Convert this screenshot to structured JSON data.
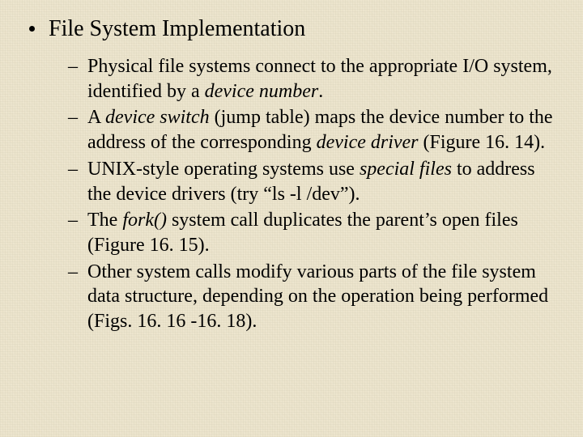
{
  "slide": {
    "title": "File System Implementation",
    "dash": "–",
    "items": [
      {
        "seg0": "Physical file systems connect to the appropriate I/O system, identified by a ",
        "em1": "device number",
        "seg2": "."
      },
      {
        "seg0": "A ",
        "em1": "device switch",
        "seg2": " (jump table) maps the device number to the address of the corresponding ",
        "em3": "device driver",
        "seg4": " (Figure 16. 14)."
      },
      {
        "seg0": "UNIX-style operating systems use ",
        "em1": "special files",
        "seg2": " to address the device drivers (try “ls -l /dev”)."
      },
      {
        "seg0": "The ",
        "em1": "fork()",
        "seg2": " system call duplicates the parent’s open files (Figure 16. 15)."
      },
      {
        "seg0": "Other system calls modify various parts of the file system data structure, depending on the operation being performed (Figs. 16. 16 -16. 18)."
      }
    ]
  }
}
